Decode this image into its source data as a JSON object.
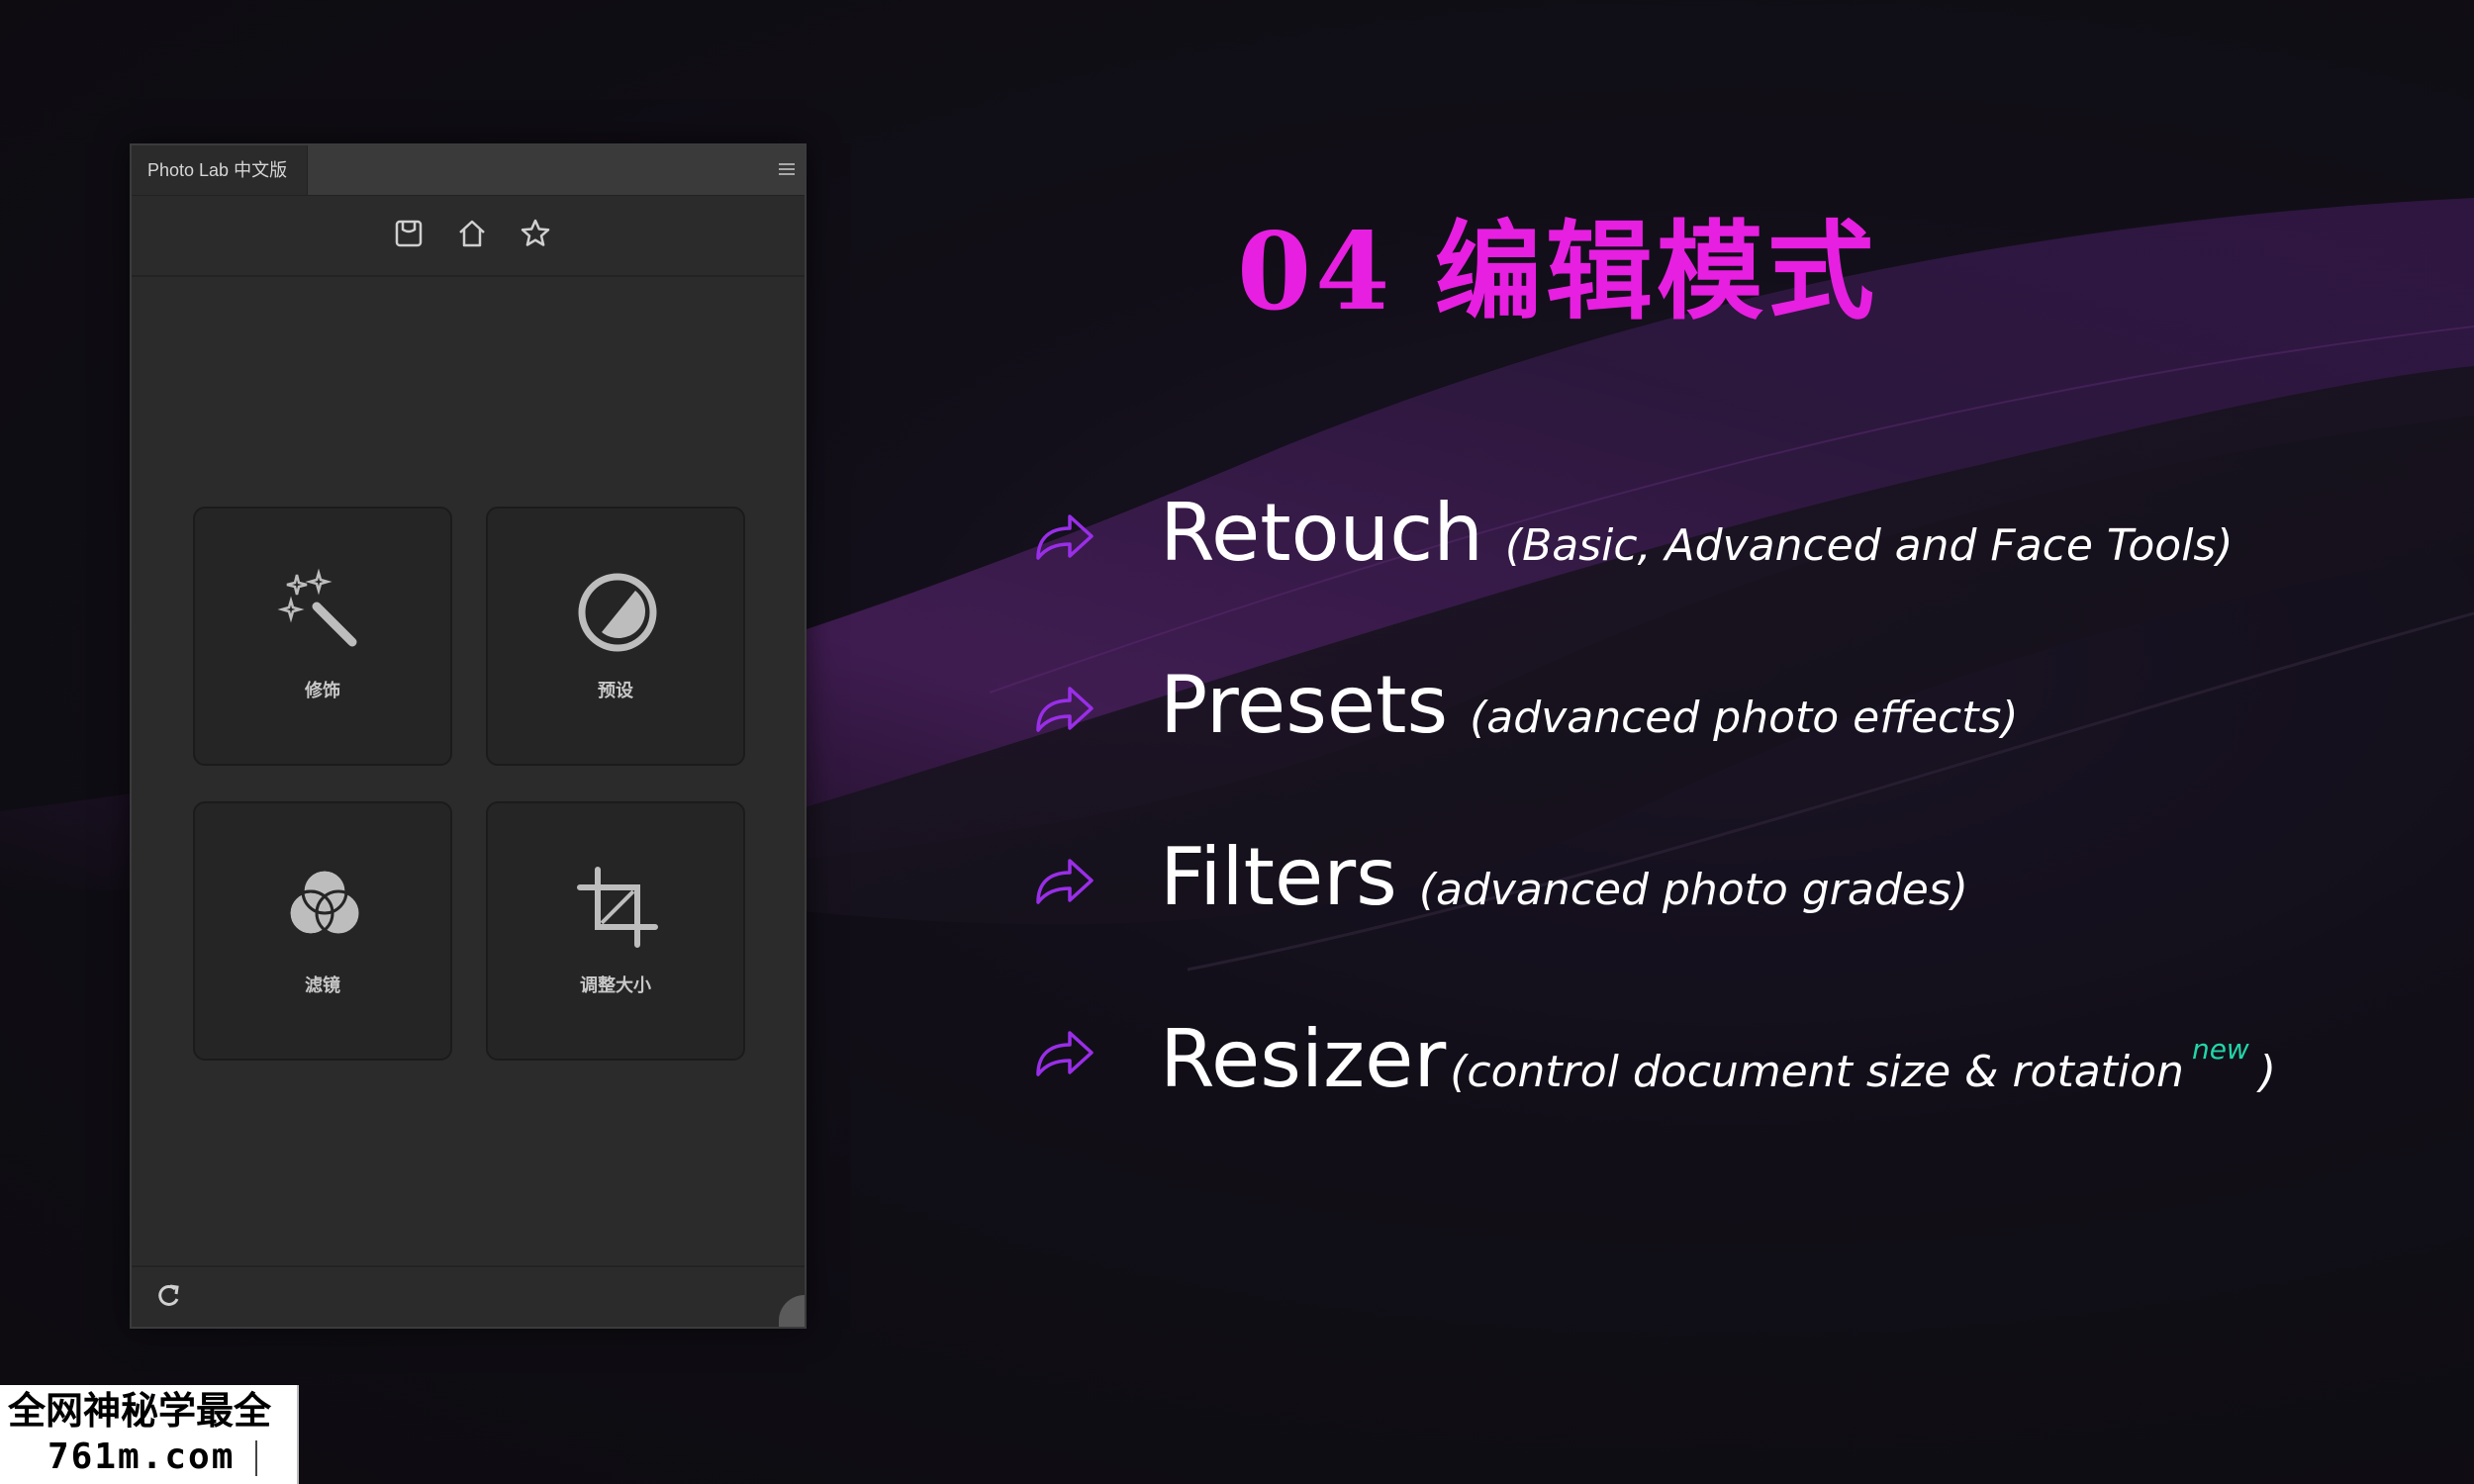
{
  "panel": {
    "tab_title": "Photo Lab 中文版",
    "menu_icon": "hamburger-menu-icon",
    "toolbar": [
      {
        "name": "save-icon"
      },
      {
        "name": "home-icon"
      },
      {
        "name": "star-icon"
      }
    ],
    "tiles": [
      {
        "label": "修饰",
        "icon": "magic-wand-icon"
      },
      {
        "label": "预设",
        "icon": "preset-circle-icon"
      },
      {
        "label": "滤镜",
        "icon": "filter-circles-icon"
      },
      {
        "label": "调整大小",
        "icon": "crop-icon"
      }
    ],
    "footer_icon": "refresh-icon"
  },
  "slide": {
    "title": "04 编辑模式",
    "title_color": "#e61fe0",
    "features": [
      {
        "title": "Retouch",
        "desc": "(Basic, Advanced and Face Tools)"
      },
      {
        "title": "Presets",
        "desc": "(advanced photo effects)"
      },
      {
        "title": "Filters",
        "desc": "(advanced photo grades)"
      },
      {
        "title": "Resizer",
        "desc": "(control document size & rotation",
        "badge": "new",
        "desc_end": ")"
      }
    ],
    "arrow_color": "#9a2ee8",
    "badge_color": "#22d6a8"
  },
  "watermark": {
    "line1": "全网神秘学最全",
    "line2": "761m.com"
  }
}
